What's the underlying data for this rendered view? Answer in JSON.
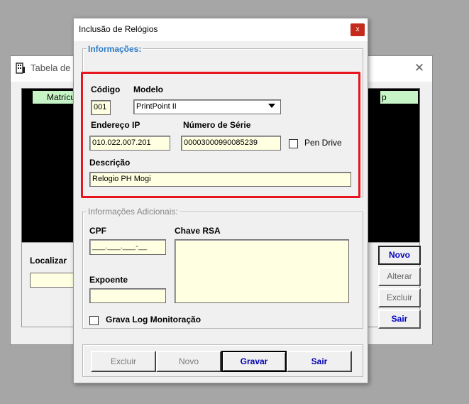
{
  "background_window": {
    "title": "Tabela de",
    "close_glyph": "✕",
    "grid_header_1": "Matrícula",
    "grid_header_2": "p",
    "localizar_label": "Localizar",
    "buttons": {
      "novo": "Novo",
      "alterar": "Alterar",
      "excluir": "Excluir",
      "sair": "Sair"
    }
  },
  "dialog": {
    "title": "Inclusão de Relógios",
    "close_glyph": "x",
    "informacoes": {
      "group_label": "Informações:",
      "codigo_label": "Código",
      "codigo_value": "001",
      "modelo_label": "Modelo",
      "modelo_value": "PrintPoint II",
      "endereco_label": "Endereço IP",
      "endereco_value": "010.022.007.201",
      "serie_label": "Número de Série",
      "serie_value": "00003000990085239",
      "pendrive_label": "Pen Drive",
      "pendrive_checked": false,
      "descricao_label": "Descrição",
      "descricao_value": "Relogio PH Mogi"
    },
    "adicionais": {
      "group_label": "Informações Adicionais:",
      "cpf_label": "CPF",
      "cpf_mask": "___.___.___-__",
      "rsa_label": "Chave RSA",
      "rsa_value": "",
      "expoente_label": "Expoente",
      "expoente_value": "",
      "log_label": "Grava Log Monitoração",
      "log_checked": false
    },
    "buttons": {
      "excluir": "Excluir",
      "novo": "Novo",
      "gravar": "Gravar",
      "sair": "Sair"
    }
  },
  "colors": {
    "highlight": "#e8141f",
    "field_background": "#ffffe1",
    "group_label_blue": "#2b7bc8",
    "button_text_blue": "#0000b0",
    "grid_header_green": "#c6f4c6"
  },
  "icons": {
    "app_icon": "building-icon",
    "dropdown": "triangle-down-icon"
  }
}
